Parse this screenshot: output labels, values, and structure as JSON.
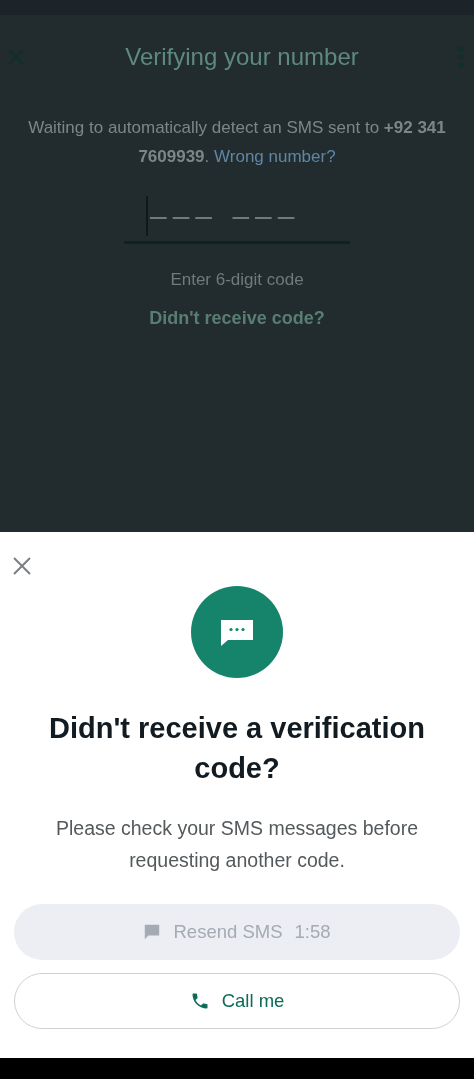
{
  "background_screen": {
    "title": "Verifying your number",
    "message": "Waiting to automatically detect an SMS sent to **+92 341 7609939**.",
    "wrong_number_link": "Wrong number?",
    "code_placeholder": "––– –––",
    "code_hint": "Enter 6-digit code",
    "didnt_receive_link": "Didn't receive code?"
  },
  "sheet": {
    "title": "Didn't receive a verification code?",
    "description": "Please check your SMS messages before requesting another code.",
    "buttons": [
      {
        "kind": "sms",
        "label": "Resend SMS",
        "timer": "1:58",
        "disabled": true
      },
      {
        "kind": "call",
        "label": "Call me",
        "disabled": false
      }
    ]
  }
}
